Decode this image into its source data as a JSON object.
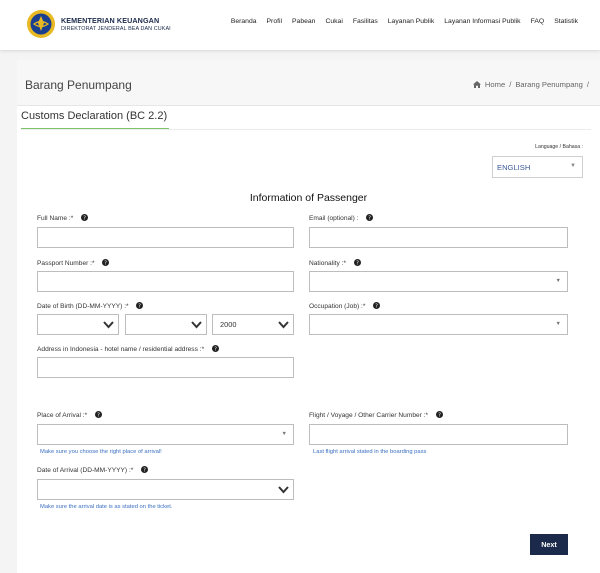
{
  "header": {
    "brand_line1": "KEMENTERIAN KEUANGAN",
    "brand_line2": "DIREKTORAT JENDERAL BEA DAN CUKAI",
    "nav": [
      "Beranda",
      "Profil",
      "Pabean",
      "Cukai",
      "Fasilitas",
      "Layanan Publik",
      "Layanan Informasi Publik",
      "FAQ",
      "Statistik"
    ]
  },
  "page": {
    "title": "Barang Penumpang",
    "breadcrumb_home": "Home",
    "breadcrumb_sep": "/",
    "breadcrumb_current": "Barang Penumpang",
    "breadcrumb_trail": "/"
  },
  "section_tab": "Customs Declaration (BC 2.2)",
  "language": {
    "label": "Language / Bahasa :",
    "selected": "ENGLISH"
  },
  "form": {
    "heading": "Information of Passenger",
    "full_name_label": "Full Name :*",
    "email_label": "Email (optional) :",
    "passport_label": "Passport Number :*",
    "nationality_label": "Nationality :*",
    "dob_label": "Date of Birth (DD-MM-YYYY) :*",
    "dob_year": "2000",
    "occupation_label": "Occupation (Job) :*",
    "address_label": "Address in Indonesia - hotel name / residential address :*",
    "arrival_place_label": "Place of Arrival :*",
    "arrival_place_hint": "Make sure you choose the right place of arrival!",
    "flight_label": "Flight / Voyage / Other Carrier Number :*",
    "flight_hint": "Last flight arrival stated in the boarding pass",
    "arrival_date_label": "Date of Arrival (DD-MM-YYYY) :*",
    "arrival_date_hint": "Make sure the arrival date is as stated on the ticket.",
    "next_label": "Next"
  },
  "colors": {
    "navy": "#1b2a4a",
    "accent_green": "#7cc36a",
    "hint_blue": "#3b6fc2"
  }
}
